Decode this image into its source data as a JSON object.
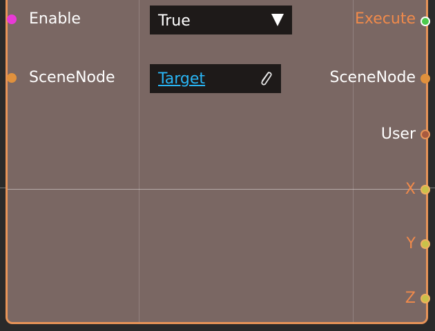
{
  "node": {
    "inputs": [
      {
        "label": "Enable",
        "port_color": "#e83ad6",
        "port_border": "#e83ad6"
      },
      {
        "label": "SceneNode",
        "port_color": "#e0913d",
        "port_border": "#e0913d"
      }
    ],
    "outputs": [
      {
        "label": "Execute",
        "label_color": "#f08a4b",
        "port_color": "#4cc94c",
        "port_border": "#ffffff"
      },
      {
        "label": "SceneNode",
        "label_color": "#ffffff",
        "port_color": "#e0913d",
        "port_border": "#e0913d"
      },
      {
        "label": "User",
        "label_color": "#ffffff",
        "port_color": "#a85a3f",
        "port_border": "#e89458"
      },
      {
        "label": "X",
        "label_color": "#f08a4b",
        "port_color": "#c9c24a",
        "port_border": "#f0b060"
      },
      {
        "label": "Y",
        "label_color": "#f08a4b",
        "port_color": "#c9c24a",
        "port_border": "#f0b060"
      },
      {
        "label": "Z",
        "label_color": "#f08a4b",
        "port_color": "#c9c24a",
        "port_border": "#f0b060"
      }
    ],
    "enable_dropdown": {
      "value": "True",
      "icon": "triangle-down-icon"
    },
    "scenenode_field": {
      "value": "Target",
      "icon": "paperclip-icon"
    },
    "colors": {
      "node_body": "#7a6763",
      "node_border": "#e89458",
      "field_bg": "#1e1a19",
      "link": "#29b6f6"
    }
  }
}
